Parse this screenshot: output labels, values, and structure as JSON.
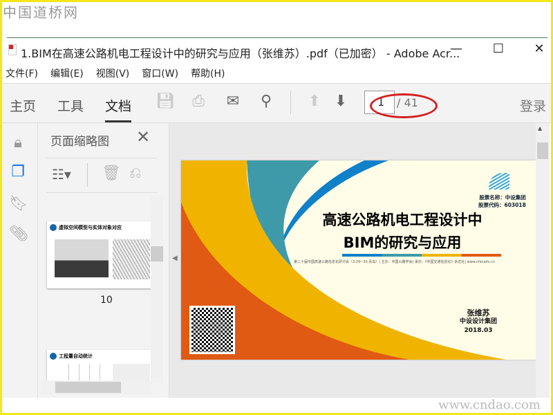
{
  "watermark_top": "中国道桥网",
  "watermark_bottom": "www.cndao.com",
  "window": {
    "title": "1.BIM在高速公路机电工程设计中的研究与应用（张维苏）.pdf（已加密） - Adobe Acr...",
    "minimize": "—",
    "maximize": "☐",
    "close": "✕"
  },
  "menu": [
    "文件(F)",
    "编辑(E)",
    "视图(V)",
    "窗口(W)",
    "帮助(H)"
  ],
  "toolbar": {
    "tabs": [
      "主页",
      "工具",
      "文档"
    ],
    "active_tab": "文档",
    "page_current": "1",
    "page_total": "/ 41",
    "login": "登录"
  },
  "thumbnails": {
    "title": "页面缩略图",
    "pages": [
      {
        "label": "10",
        "heading": "虚拟空间模型与实体对象对应"
      },
      {
        "label": "",
        "heading": "工程量自动统计"
      }
    ]
  },
  "slide": {
    "stock_name": "股票名称：中设集团",
    "stock_code": "股票代码：603018",
    "title_line1": "高速公路机电工程设计中",
    "title_line2": "BIM的研究与应用",
    "conference": "第二十届中国高速公路信息化研讨会（3.29~30,青岛）| 主办：中国公路学会| 承办：《中国交通信息化》杂志社| www.chinaits.cn",
    "author": "张维苏",
    "org": "中设设计集团",
    "date": "2018.03"
  },
  "colors": {
    "orange": "#e05a14",
    "yellow": "#f0b400",
    "teal": "#3e9aa8",
    "blue": "#1080c8",
    "cream": "#fffde8",
    "annotation": "#d42020"
  }
}
